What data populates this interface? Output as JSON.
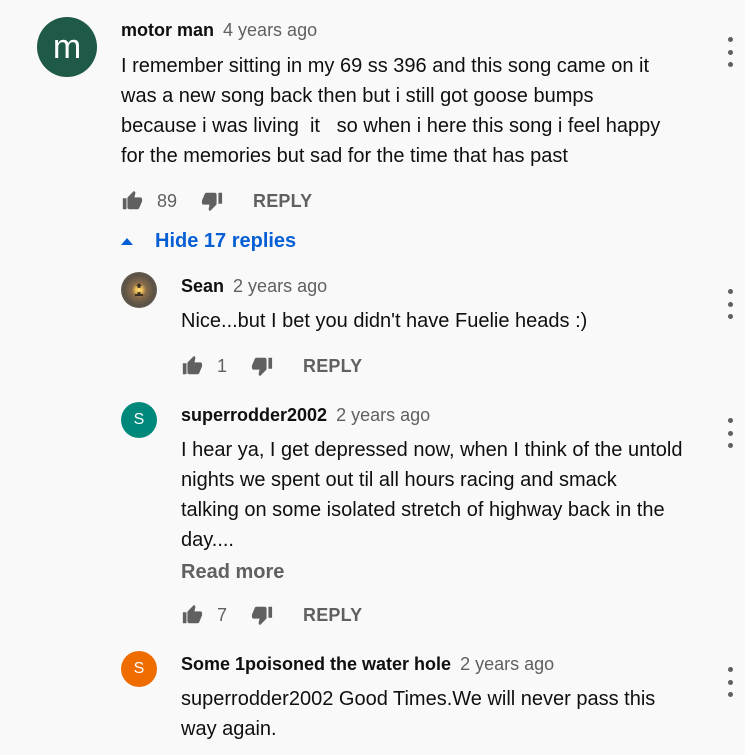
{
  "comments": [
    {
      "avatar_letter": "m",
      "author": "motor man",
      "time": "4 years ago",
      "lines": [
        "I remember sitting in my 69 ss 396 and this song came on it",
        "was a new song back then but i still got goose bumps",
        "because i was living  it   so when i here this song i feel happy",
        "for the memories but sad for the time that has past"
      ],
      "likes": "89",
      "reply_label": "REPLY"
    }
  ],
  "hide_replies_label": "Hide 17 replies",
  "replies": [
    {
      "author": "Sean",
      "time": "2 years ago",
      "lines": [
        "Nice...but I bet you didn't have Fuelie heads :)"
      ],
      "likes": "1",
      "reply_label": "REPLY"
    },
    {
      "avatar_letter": "S",
      "avatar_color": "#00897b",
      "author": "superrodder2002",
      "time": "2 years ago",
      "lines": [
        "I hear ya, I get depressed now, when I think of the untold",
        "nights we spent out til all hours racing and smack",
        "talking on some isolated stretch of highway back in the",
        "day...."
      ],
      "read_more": "Read more",
      "likes": "7",
      "reply_label": "REPLY"
    },
    {
      "avatar_letter": "S",
      "avatar_color": "#ef6c00",
      "author": "Some 1poisoned the water hole",
      "time": "2 years ago",
      "lines": [
        "superrodder2002 Good Times.We will never pass this",
        "way again."
      ]
    }
  ]
}
